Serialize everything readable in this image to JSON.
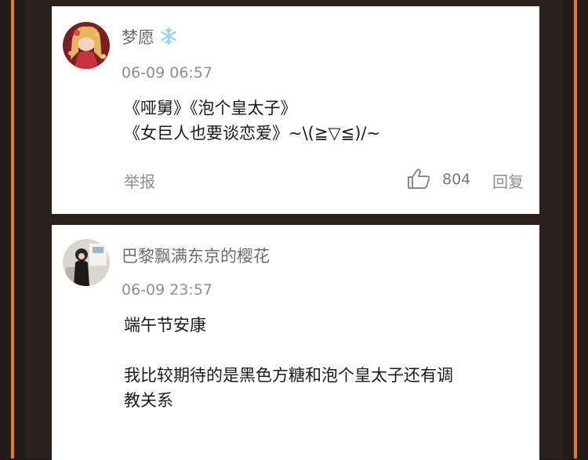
{
  "comments": [
    {
      "username": "梦愿",
      "badge_icon": "snowflake-icon",
      "timestamp": "06-09 06:57",
      "content": "《哑舅》《泡个皇太子》\n《女巨人也要谈恋爱》~\\(≧▽≦)/~",
      "report_label": "举报",
      "likes": "804",
      "reply_label": "回复",
      "avatar_icon": "anime-girl-avatar"
    },
    {
      "username": "巴黎飘满东京的樱花",
      "timestamp": "06-09 23:57",
      "content": "端午节安康\n\n我比较期待的是黑色方糖和泡个皇太子还有调\n教关系",
      "avatar_icon": "girl-photo-avatar"
    }
  ],
  "colors": {
    "frame_accent": "#e07a2c",
    "background": "#231b17",
    "card": "#ffffff",
    "username": "#6b6b6b",
    "meta": "#8e8e8e",
    "badge": "#8fd3f0"
  }
}
